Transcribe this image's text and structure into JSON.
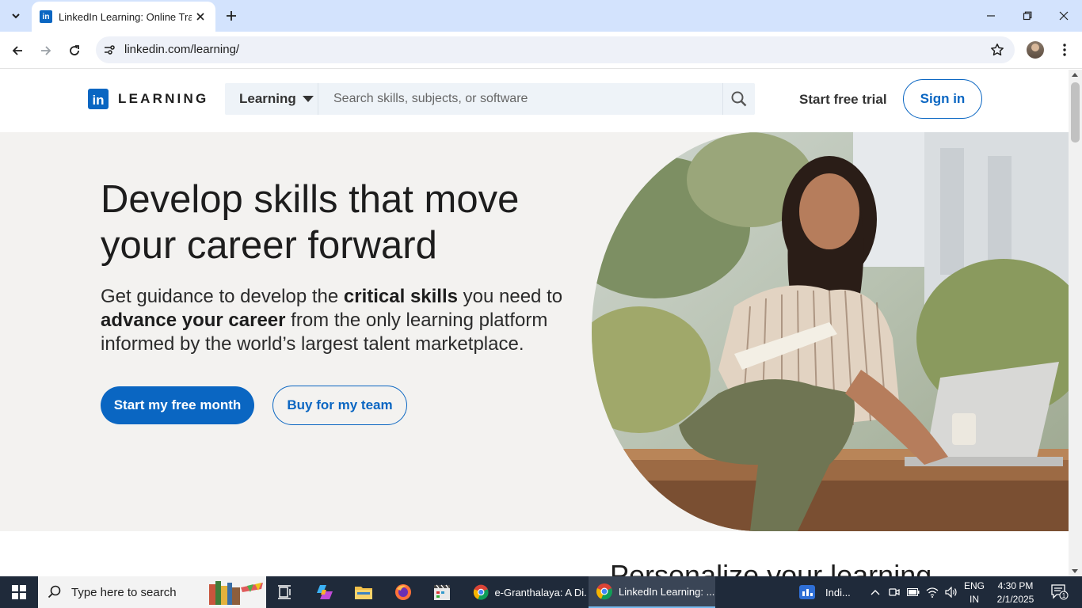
{
  "browser": {
    "tab_title": "LinkedIn Learning: Online Traini",
    "favicon_text": "in",
    "url": "linkedin.com/learning/"
  },
  "header": {
    "logo_in": "in",
    "logo_word": "LEARNING",
    "dropdown_label": "Learning",
    "search_placeholder": "Search skills, subjects, or software",
    "trial_link": "Start free trial",
    "signin_label": "Sign in"
  },
  "hero": {
    "title": "Develop skills that move your career forward",
    "sub_1": "Get guidance to develop the ",
    "sub_bold_1": "critical skills",
    "sub_2": " you need to ",
    "sub_bold_2": "advance your career",
    "sub_3": " from the only learning platform informed by the world’s largest talent marketplace.",
    "primary_cta": "Start my free month",
    "secondary_cta": "Buy for my team"
  },
  "section2": {
    "heading": "Personalize your learning"
  },
  "taskbar": {
    "search_text": "Type here to search",
    "apps": [
      {
        "label": "e-Granthalaya: A Di..."
      },
      {
        "label": "LinkedIn Learning: ..."
      }
    ],
    "weather_text": "Indi...",
    "lang_1": "ENG",
    "lang_2": "IN",
    "time": "4:30 PM",
    "date": "2/1/2025",
    "notification_count": "1"
  },
  "colors": {
    "brand_blue": "#0a66c2",
    "hero_bg": "#f3f2f0",
    "tabstrip": "#d3e3fd"
  }
}
